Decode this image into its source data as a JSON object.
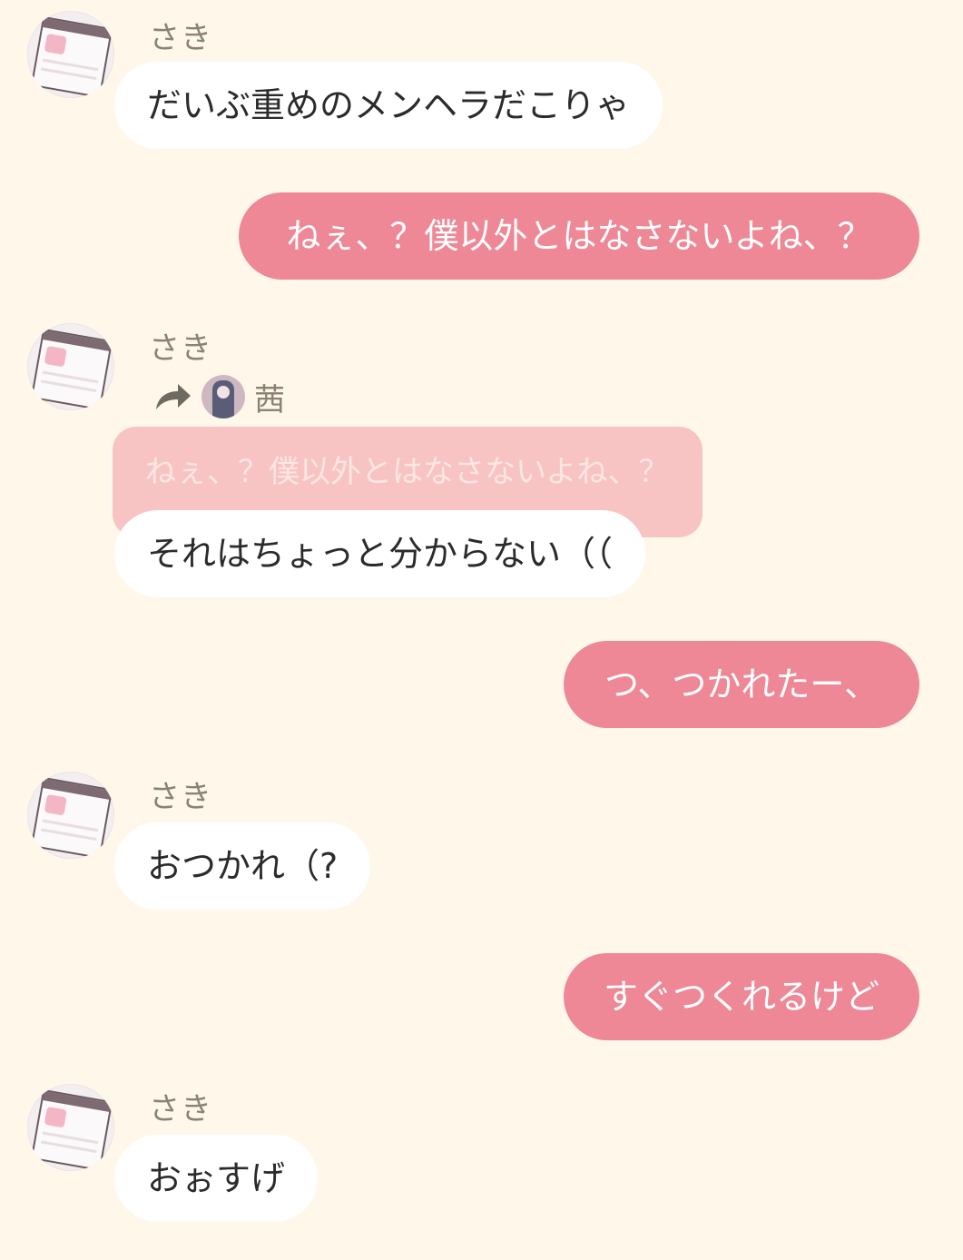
{
  "messages": [
    {
      "sender": "さき",
      "text": "だいぶ重めのメンヘラだこりゃ"
    },
    {
      "sender": "self",
      "text": "ねぇ、？僕以外とはなさないよね、？"
    },
    {
      "sender": "さき",
      "reply_to": {
        "name": "茜",
        "text": "ねぇ、？僕以外とはなさないよね、？"
      },
      "text": "それはちょっと分からない（（"
    },
    {
      "sender": "self",
      "text": "つ、つかれたー、"
    },
    {
      "sender": "さき",
      "text": "おつかれ（?"
    },
    {
      "sender": "self",
      "text": "すぐつくれるけど"
    },
    {
      "sender": "さき",
      "text": "おぉすげ"
    }
  ],
  "icons": {
    "reply": "reply-arrow-icon",
    "avatar": "avatar-image"
  },
  "colors": {
    "background": "#fff8ea",
    "outgoing_bubble": "#ee8796",
    "incoming_bubble": "#ffffff",
    "quote_bubble": "#f8c4c3",
    "name_text": "#8b8273"
  }
}
